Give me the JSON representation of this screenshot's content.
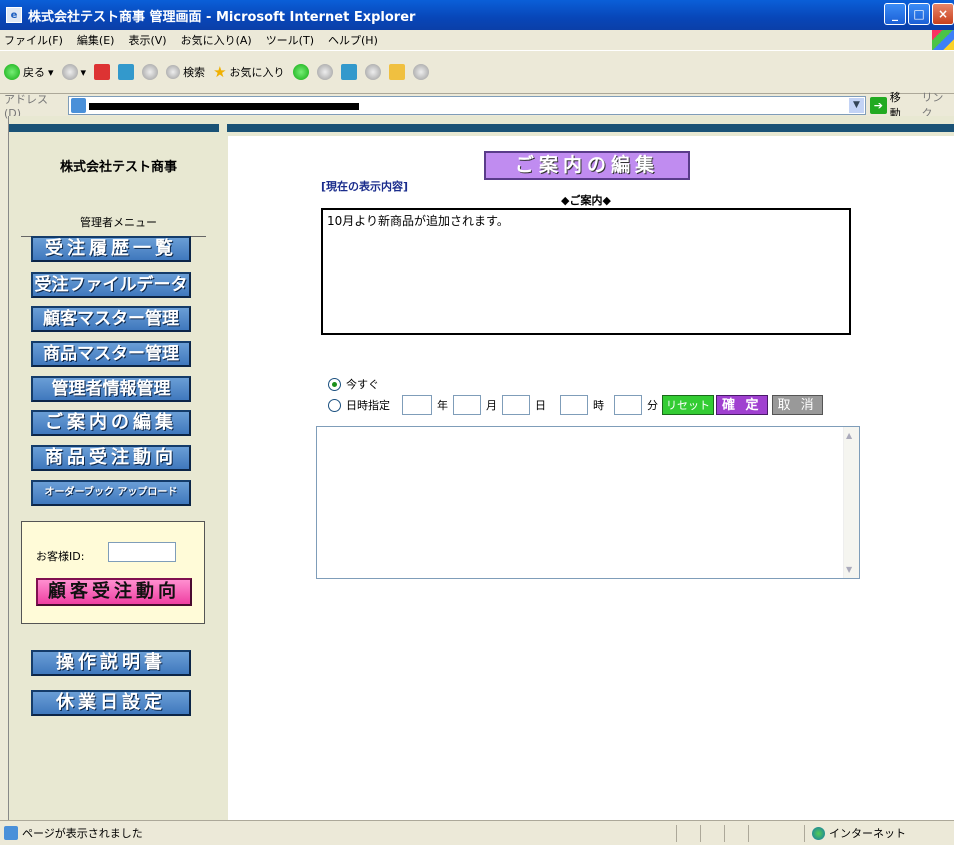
{
  "window": {
    "title": "株式会社テスト商事  管理画面 - Microsoft Internet Explorer",
    "buttons": [
      "minimize-icon",
      "maximize-icon",
      "close-icon"
    ]
  },
  "menubar": [
    "ファイル(F)",
    "編集(E)",
    "表示(V)",
    "お気に入り(A)",
    "ツール(T)",
    "ヘルプ(H)"
  ],
  "toolbar": {
    "back": "戻る",
    "search": "検索",
    "favorites": "お気に入り"
  },
  "addressbar": {
    "label": "アドレス(D)",
    "go": "移動",
    "links": "リンク"
  },
  "sidebar": {
    "company": "株式会社テスト商事",
    "menu_title": "管理者メニュー",
    "items": [
      {
        "label": "受注履歴一覧"
      },
      {
        "label": "受注ファイルデータ"
      },
      {
        "label": "顧客マスター管理"
      },
      {
        "label": "商品マスター管理"
      },
      {
        "label": "管理者情報管理"
      },
      {
        "label": "ご案内の編集"
      },
      {
        "label": "商品受注動向"
      },
      {
        "label": "オーダーブック アップロード"
      }
    ],
    "customer_id_label": "お客様ID:",
    "customer_id_value": "",
    "customer_trend_button": "顧客受注動向",
    "manual_button": "操作説明書",
    "holiday_button": "休業日設定"
  },
  "main": {
    "heading": "ご案内の編集",
    "current_label": "[現在の表示内容]",
    "info_title": "◆ご案内◆",
    "info_text": "10月より新商品が追加されます。",
    "radio_now": "今すぐ",
    "radio_datetime": "日時指定",
    "unit_year": "年",
    "unit_month": "月",
    "unit_day": "日",
    "unit_hour": "時",
    "unit_minute": "分",
    "reset_button": "リセット",
    "confirm_button": "確 定",
    "cancel_button": "取 消",
    "edit_text": ""
  },
  "statusbar": {
    "text": "ページが表示されました",
    "zone": "インターネット"
  }
}
